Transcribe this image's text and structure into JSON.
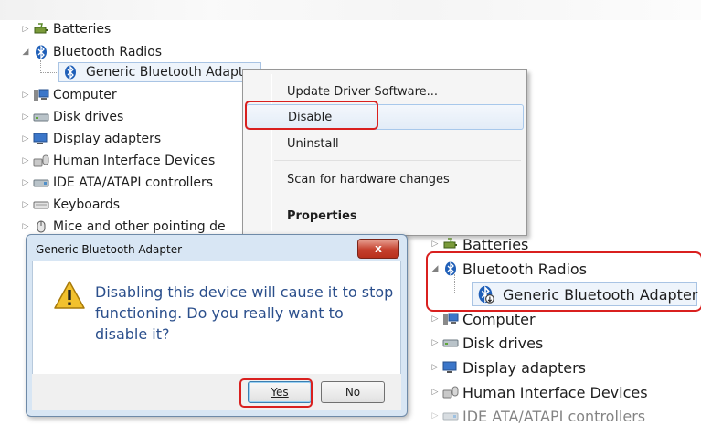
{
  "tree_top": {
    "batteries": "Batteries",
    "bluetooth_radios": "Bluetooth Radios",
    "generic_adapter": "Generic Bluetooth Adapt",
    "computer": "Computer",
    "disk_drives": "Disk drives",
    "display_adapters": "Display adapters",
    "hid": "Human Interface Devices",
    "ide": "IDE ATA/ATAPI controllers",
    "keyboards": "Keyboards",
    "mice": "Mice and other pointing de"
  },
  "context_menu": {
    "items": [
      "Update Driver Software...",
      "Disable",
      "Uninstall",
      "Scan for hardware changes",
      "Properties"
    ]
  },
  "dialog": {
    "title": "Generic Bluetooth Adapter",
    "close_label": "x",
    "message": "Disabling this device will cause it to stop functioning. Do you really want to disable it?",
    "yes_label": "Yes",
    "no_label": "No"
  },
  "tree_bottom": {
    "batteries": "Batteries",
    "bluetooth_radios": "Bluetooth Radios",
    "generic_adapter": "Generic Bluetooth Adapter",
    "computer": "Computer",
    "disk_drives": "Disk drives",
    "display_adapters": "Display adapters",
    "hid": "Human Interface Devices",
    "ide": "IDE ATA/ATAPI controllers"
  },
  "colors": {
    "highlight_red": "#d9201f",
    "bluetooth_blue": "#1f5fb8",
    "dialog_text": "#2b4f8c"
  },
  "icons": [
    "battery-icon",
    "bluetooth-icon",
    "computer-icon",
    "disk-icon",
    "monitor-icon",
    "hid-icon",
    "ide-icon",
    "keyboard-icon",
    "mouse-icon",
    "warning-icon",
    "disabled-bluetooth-icon"
  ]
}
